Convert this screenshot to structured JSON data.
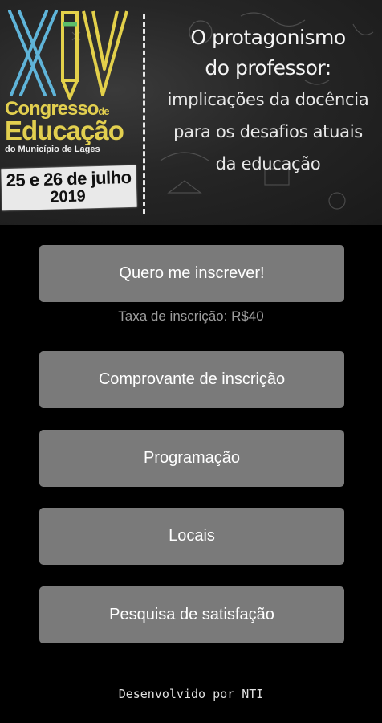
{
  "banner": {
    "roman_numeral": "XIV",
    "congress_line1": "Congresso",
    "congress_line1_suffix": "de",
    "congress_line2": "Educação",
    "congress_line3": "do Município de Lages",
    "date_line1": "25 e 26 de julho",
    "date_line2": "2019",
    "headline_line1": "O protagonismo",
    "headline_line2": "do professor:",
    "subtitle_line1": "implicações da docência",
    "subtitle_line2": "para os desafios atuais",
    "subtitle_line3": "da educação"
  },
  "actions": {
    "subscribe_label": "Quero me inscrever!",
    "fee_text": "Taxa de inscrição: R$40",
    "receipt_label": "Comprovante de inscrição",
    "program_label": "Programação",
    "places_label": "Locais",
    "survey_label": "Pesquisa de satisfação"
  },
  "footer": {
    "credit": "Desenvolvido por NTI"
  },
  "colors": {
    "background": "#000000",
    "button": "#7a7a7a",
    "button_text": "#ffffff",
    "fee_text": "#9e9e9e",
    "title_yellow": "#e2cf4f",
    "xiv_blue": "#5fb4d9",
    "xiv_yellow": "#e3d04a"
  }
}
